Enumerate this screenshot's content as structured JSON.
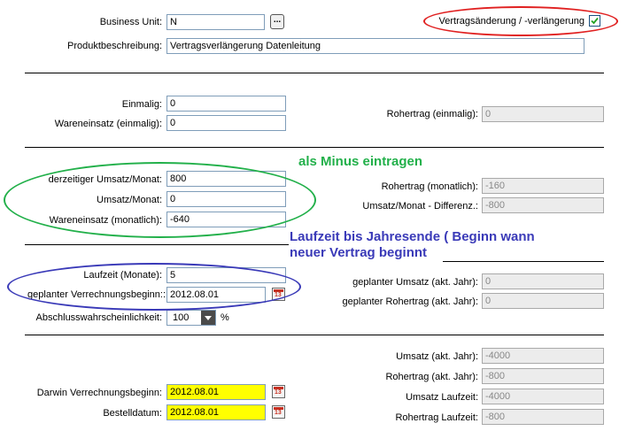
{
  "header": {
    "business_unit_label": "Business Unit:",
    "business_unit_value": "N",
    "browse_label": "...",
    "vertrag_label": "Vertragsänderung / -verlängerung",
    "vertrag_checked": true,
    "produkt_label": "Produktbeschreibung:",
    "produkt_value": "Vertragsverlängerung Datenleitung"
  },
  "einmalig": {
    "einmalig_label": "Einmalig:",
    "einmalig_value": "0",
    "wareneinsatz_label": "Wareneinsatz (einmalig):",
    "wareneinsatz_value": "0",
    "rohertrag_label": "Rohertrag (einmalig):",
    "rohertrag_value": "0"
  },
  "monatlich": {
    "derzeitiger_label": "derzeitiger Umsatz/Monat:",
    "derzeitiger_value": "800",
    "umsatz_label": "Umsatz/Monat:",
    "umsatz_value": "0",
    "wareneinsatz_label": "Wareneinsatz (monatlich):",
    "wareneinsatz_value": "-640",
    "rohertrag_label": "Rohertrag (monatlich):",
    "rohertrag_value": "-160",
    "differenz_label": "Umsatz/Monat - Differenz.:",
    "differenz_value": "-800"
  },
  "laufzeit": {
    "laufzeit_label": "Laufzeit (Monate):",
    "laufzeit_value": "5",
    "beginn_label": "geplanter Verrechnungsbeginn::",
    "beginn_value": "2012.08.01",
    "abschluss_label": "Abschlusswahrscheinlichkeit:",
    "abschluss_value": "100",
    "percent": "%",
    "geplanter_umsatz_label": "geplanter Umsatz (akt. Jahr):",
    "geplanter_umsatz_value": "0",
    "geplanter_rohertrag_label": "geplanter Rohertrag (akt. Jahr):",
    "geplanter_rohertrag_value": "0"
  },
  "summary": {
    "darwin_label": "Darwin Verrechnungsbeginn:",
    "darwin_value": "2012.08.01",
    "bestell_label": "Bestelldatum:",
    "bestell_value": "2012.08.01",
    "umsatz_jahr_label": "Umsatz (akt. Jahr):",
    "umsatz_jahr_value": "-4000",
    "rohertrag_jahr_label": "Rohertrag (akt. Jahr):",
    "rohertrag_jahr_value": "-800",
    "umsatz_laufzeit_label": "Umsatz Laufzeit:",
    "umsatz_laufzeit_value": "-4000",
    "rohertrag_laufzeit_label": "Rohertrag Laufzeit:",
    "rohertrag_laufzeit_value": "-800"
  },
  "annotations": {
    "minus": "als Minus eintragen",
    "laufzeit_line1": "Laufzeit bis Jahresende ( Beginn wann",
    "laufzeit_line2": "neuer Vertrag beginnt"
  },
  "calendar_icon_text": "13",
  "colors": {
    "annotation_green": "#22b04a",
    "annotation_blue": "#3a3ab8",
    "annotation_red": "#e02020",
    "highlight_yellow": "#ffff00"
  }
}
